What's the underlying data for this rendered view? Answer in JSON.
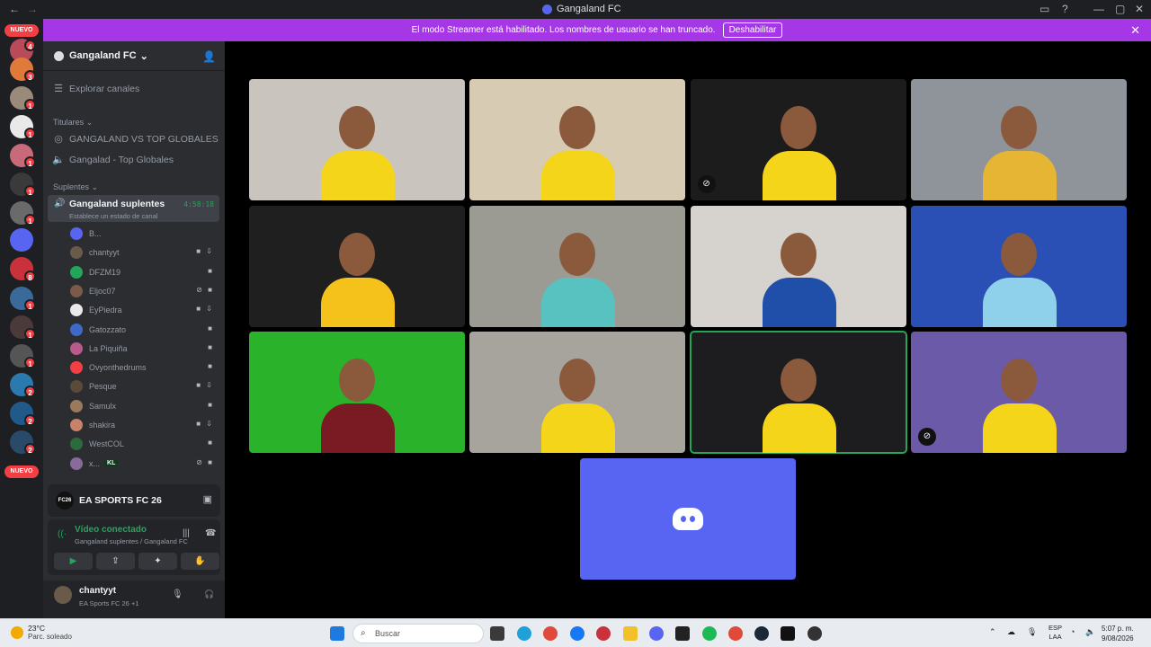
{
  "window": {
    "title": "Gangaland FC",
    "back": "←",
    "forward": "→",
    "controls": [
      "▭",
      "?",
      "—",
      "▢",
      "✕"
    ]
  },
  "rail": {
    "badges": [
      {
        "label": "NUEVO",
        "kind": "new"
      },
      {
        "count": "4"
      },
      {
        "count": "3"
      },
      {
        "count": "1"
      },
      {
        "count": "1"
      },
      {
        "count": "1"
      },
      {
        "count": "1"
      },
      {
        "count": "1"
      },
      {
        "count": "8"
      },
      {
        "count": "1"
      },
      {
        "count": "1"
      },
      {
        "count": "1"
      },
      {
        "count": "2"
      },
      {
        "count": "2"
      },
      {
        "count": "2"
      },
      {
        "label": "NUEVO",
        "kind": "new"
      }
    ]
  },
  "banner": {
    "text": "El modo Streamer está habilitado. Los nombres de usuario se han truncado.",
    "button": "Deshabilitar",
    "close": "✕"
  },
  "guild": {
    "name": "Gangaland FC",
    "chevron": "⌄",
    "explore": "Explorar canales",
    "categories": [
      {
        "name": "Titulares",
        "channels": [
          "GANGALAND VS TOP GLOBALES",
          "Gangalad - Top Globales"
        ]
      },
      {
        "name": "Suplentes"
      }
    ],
    "active_channel": {
      "name": "Gangaland suplentes",
      "time": "4:58:18",
      "status": "Establece un estado de canal"
    },
    "members": [
      {
        "name": "B...",
        "color": "#5865f2",
        "icons": ""
      },
      {
        "name": "chantyyt",
        "color": "#6a5a4a",
        "icons": "■ ⇩"
      },
      {
        "name": "DFZM19",
        "color": "#23a55a",
        "icons": "■"
      },
      {
        "name": "Eljoc07",
        "color": "#7a5a48",
        "icons": "⊘ ■"
      },
      {
        "name": "EyPiedra",
        "color": "#e9e9e9",
        "icons": "■ ⇩"
      },
      {
        "name": "Gatozzato",
        "color": "#3f69c9",
        "icons": "■"
      },
      {
        "name": "La Piquiña",
        "color": "#b85a8a",
        "icons": "■"
      },
      {
        "name": "Ovyonthedrums",
        "color": "#f23f43",
        "icons": "■"
      },
      {
        "name": "Pesque",
        "color": "#5a4a3a",
        "icons": "■ ⇩"
      },
      {
        "name": "Samulx",
        "color": "#9a7a5a",
        "icons": "■"
      },
      {
        "name": "shakira",
        "color": "#c9826a",
        "icons": "■ ⇩"
      },
      {
        "name": "WestCOL",
        "color": "#2b6a3a",
        "icons": "■"
      },
      {
        "name": "x...",
        "color": "#8a6a9a",
        "icons": "⊘ ■",
        "tag": "KL"
      }
    ]
  },
  "game": {
    "logo": "FC26",
    "name": "EA SPORTS FC 26"
  },
  "voice": {
    "status": "Vídeo conectado",
    "location": "Gangaland suplentes / Gangaland FC",
    "buttons": [
      "▶",
      "⇪",
      "✦",
      "✋"
    ]
  },
  "user": {
    "name": "chantyyt",
    "activity": "EA Sports FC 26 +1",
    "mic": "🎙",
    "headset": "🎧",
    "settings": "⚙"
  },
  "stage": {
    "tiles": [
      {
        "bg": "#c9c4bd",
        "shirt": "#f4d51a",
        "muted": false,
        "speaking": false
      },
      {
        "bg": "#d8cbb3",
        "shirt": "#f4d51a",
        "muted": false,
        "speaking": false
      },
      {
        "bg": "#1c1c1c",
        "shirt": "#f4d51a",
        "muted": true,
        "speaking": false
      },
      {
        "bg": "#8e9499",
        "shirt": "#e5b533",
        "muted": false,
        "speaking": false
      },
      {
        "bg": "#1f1f1f",
        "shirt": "#f4c21a",
        "muted": false,
        "speaking": false
      },
      {
        "bg": "#9b9b94",
        "shirt": "#57c2c0",
        "muted": false,
        "speaking": false
      },
      {
        "bg": "#d6d3cf",
        "shirt": "#1f4fa8",
        "muted": false,
        "speaking": false
      },
      {
        "bg": "#2a4fb5",
        "shirt": "#8fd0ea",
        "muted": false,
        "speaking": false
      },
      {
        "bg": "#2bb22b",
        "shirt": "#7a1a22",
        "muted": false,
        "speaking": false
      },
      {
        "bg": "#a7a39d",
        "shirt": "#f4d51a",
        "muted": false,
        "speaking": false
      },
      {
        "bg": "#1d1d1f",
        "shirt": "#f4d51a",
        "muted": false,
        "speaking": true
      },
      {
        "bg": "#6a5aa8",
        "shirt": "#f4d51a",
        "muted": true,
        "speaking": false
      }
    ]
  },
  "taskbar": {
    "weather_temp": "23°C",
    "weather_desc": "Parc. soleado",
    "search": "Buscar",
    "lang1": "ESP",
    "lang2": "LAA",
    "time": "5:07 p. m.",
    "date": "9/08/2026"
  }
}
